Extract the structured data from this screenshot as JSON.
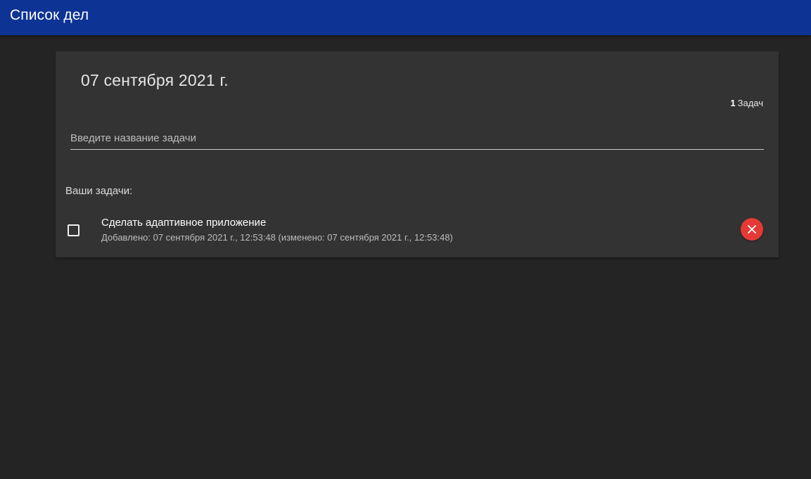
{
  "app_bar": {
    "title": "Список дел"
  },
  "card": {
    "date_heading": "07 сентября 2021 г.",
    "counter": {
      "count": "1",
      "label": "Задач"
    },
    "new_task_input": {
      "value": "",
      "placeholder": "Введите название задачи"
    },
    "section_label": "Ваши задачи:",
    "tasks": [
      {
        "title": "Сделать адаптивное приложение",
        "meta": "Добавлено: 07 сентября 2021 г., 12:53:48 (изменено: 07 сентября 2021 г., 12:53:48)",
        "checked": false,
        "delete_icon": "close-icon"
      }
    ]
  },
  "colors": {
    "app_bar": "#0d3394",
    "background": "#242424",
    "card": "#333333",
    "delete_button": "#e53935"
  }
}
